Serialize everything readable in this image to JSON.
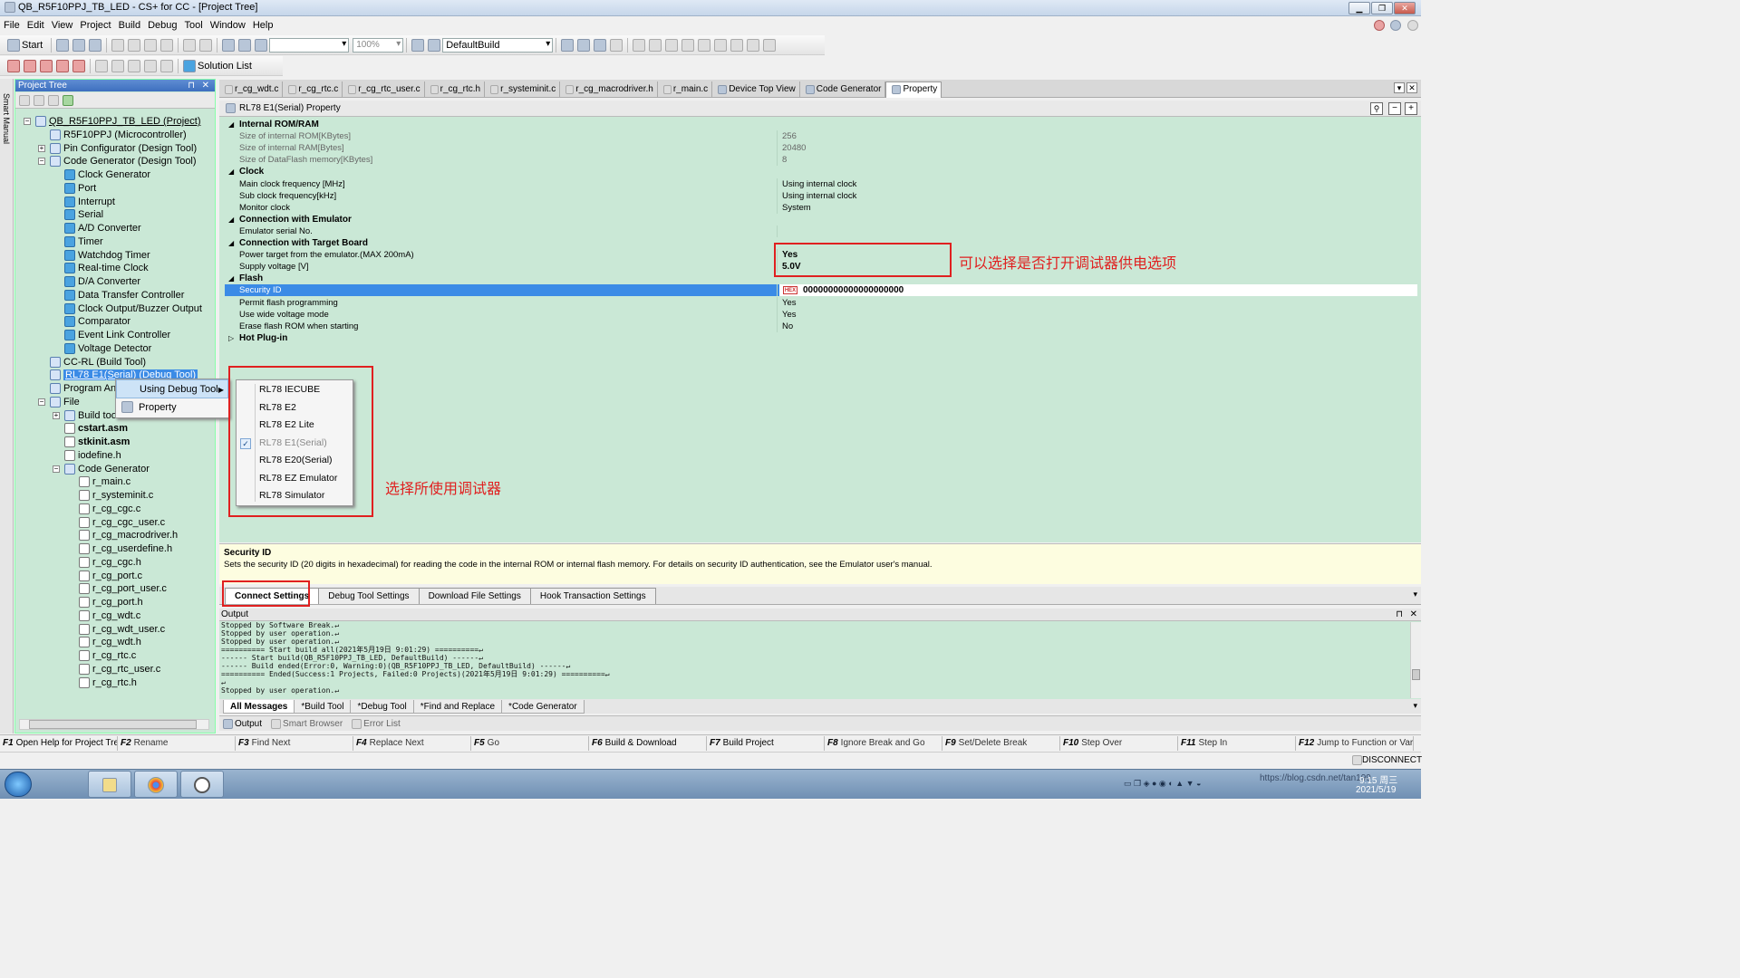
{
  "window": {
    "title": "QB_R5F10PPJ_TB_LED - CS+ for CC - [Project Tree]"
  },
  "menu": [
    "File",
    "Edit",
    "View",
    "Project",
    "Build",
    "Debug",
    "Tool",
    "Window",
    "Help"
  ],
  "toolbar": {
    "start_label": "Start",
    "zoom": "100%",
    "build_mode": "DefaultBuild",
    "solution_list": "Solution List"
  },
  "side_strip": {
    "label": "Smart Manual"
  },
  "project_tree": {
    "header": "Project Tree",
    "nodes": [
      {
        "label": "QB_R5F10PPJ_TB_LED (Project)"
      },
      {
        "label": "R5F10PPJ (Microcontroller)"
      },
      {
        "label": "Pin Configurator (Design Tool)"
      },
      {
        "label": "Code Generator (Design Tool)"
      },
      {
        "label": "Clock Generator"
      },
      {
        "label": "Port"
      },
      {
        "label": "Interrupt"
      },
      {
        "label": "Serial"
      },
      {
        "label": "A/D Converter"
      },
      {
        "label": "Timer"
      },
      {
        "label": "Watchdog Timer"
      },
      {
        "label": "Real-time Clock"
      },
      {
        "label": "D/A Converter"
      },
      {
        "label": "Data Transfer Controller"
      },
      {
        "label": "Clock Output/Buzzer Output"
      },
      {
        "label": "Comparator"
      },
      {
        "label": "Event Link Controller"
      },
      {
        "label": "Voltage Detector"
      },
      {
        "label": "CC-RL (Build Tool)"
      },
      {
        "label": "RL78 E1(Serial) (Debug Tool)"
      },
      {
        "label": "Program An"
      },
      {
        "label": "File"
      },
      {
        "label": "Build too"
      },
      {
        "label": "cstart.asm"
      },
      {
        "label": "stkinit.asm"
      },
      {
        "label": "iodefine.h"
      },
      {
        "label": "Code Generator"
      },
      {
        "label": "r_main.c"
      },
      {
        "label": "r_systeminit.c"
      },
      {
        "label": "r_cg_cgc.c"
      },
      {
        "label": "r_cg_cgc_user.c"
      },
      {
        "label": "r_cg_macrodriver.h"
      },
      {
        "label": "r_cg_userdefine.h"
      },
      {
        "label": "r_cg_cgc.h"
      },
      {
        "label": "r_cg_port.c"
      },
      {
        "label": "r_cg_port_user.c"
      },
      {
        "label": "r_cg_port.h"
      },
      {
        "label": "r_cg_wdt.c"
      },
      {
        "label": "r_cg_wdt_user.c"
      },
      {
        "label": "r_cg_wdt.h"
      },
      {
        "label": "r_cg_rtc.c"
      },
      {
        "label": "r_cg_rtc_user.c"
      },
      {
        "label": "r_cg_rtc.h"
      }
    ]
  },
  "context_menu": [
    {
      "label": "Using Debug Tool"
    },
    {
      "label": "Property"
    }
  ],
  "submenu": [
    {
      "label": "RL78 IECUBE"
    },
    {
      "label": "RL78 E2"
    },
    {
      "label": "RL78 E2 Lite"
    },
    {
      "label": "RL78 E1(Serial)",
      "checked": true,
      "disabled": true
    },
    {
      "label": "RL78 E20(Serial)"
    },
    {
      "label": "RL78 EZ Emulator"
    },
    {
      "label": "RL78 Simulator"
    }
  ],
  "doc_tabs": [
    "r_cg_wdt.c",
    "r_cg_rtc.c",
    "r_cg_rtc_user.c",
    "r_cg_rtc.h",
    "r_systeminit.c",
    "r_cg_macrodriver.h",
    "r_main.c",
    "Device Top View",
    "Code Generator",
    "Property"
  ],
  "property_panel": {
    "header": "RL78 E1(Serial) Property",
    "rows": [
      {
        "kind": "cat",
        "name": "Internal ROM/RAM",
        "value": ""
      },
      {
        "kind": "ro",
        "name": "Size of internal ROM[KBytes]",
        "value": "256"
      },
      {
        "kind": "ro",
        "name": "Size of internal RAM[Bytes]",
        "value": "20480"
      },
      {
        "kind": "ro",
        "name": "Size of DataFlash memory[KBytes]",
        "value": "8"
      },
      {
        "kind": "cat",
        "name": "Clock",
        "value": ""
      },
      {
        "kind": "row",
        "name": "Main clock frequency [MHz]",
        "value": "Using internal clock"
      },
      {
        "kind": "row",
        "name": "Sub clock frequency[kHz]",
        "value": "Using internal clock"
      },
      {
        "kind": "row",
        "name": "Monitor clock",
        "value": "System"
      },
      {
        "kind": "cat",
        "name": "Connection with Emulator",
        "value": ""
      },
      {
        "kind": "row",
        "name": "Emulator serial No.",
        "value": ""
      },
      {
        "kind": "cat",
        "name": "Connection with Target Board",
        "value": ""
      },
      {
        "kind": "bold",
        "name": "Power target from the emulator.(MAX 200mA)",
        "value": "Yes"
      },
      {
        "kind": "bold",
        "name": "Supply voltage [V]",
        "value": "5.0V"
      },
      {
        "kind": "cat",
        "name": "Flash",
        "value": ""
      },
      {
        "kind": "sel",
        "name": "Security ID",
        "value": "00000000000000000000"
      },
      {
        "kind": "row",
        "name": "Permit flash programming",
        "value": "Yes"
      },
      {
        "kind": "row",
        "name": "Use wide voltage mode",
        "value": "Yes"
      },
      {
        "kind": "row",
        "name": "Erase flash ROM when starting",
        "value": "No"
      },
      {
        "kind": "catc",
        "name": "Hot Plug-in",
        "value": ""
      }
    ],
    "hex_badge": "HEX"
  },
  "description": {
    "title": "Security ID",
    "text": "Sets the security ID (20 digits in hexadecimal) for reading the code in the internal ROM or internal flash memory. For details on security ID authentication, see the Emulator user's manual."
  },
  "property_tabs": [
    "Connect Settings",
    "Debug Tool Settings",
    "Download File Settings",
    "Hook Transaction Settings"
  ],
  "output": {
    "header": "Output",
    "lines": [
      "Stopped by Software Break.↵",
      "Stopped by user operation.↵",
      "Stopped by user operation.↵",
      "========== Start build all(2021年5月19日 9:01:29) ==========↵",
      "------ Start build(QB_R5F10PPJ_TB_LED, DefaultBuild) ------↵",
      "------ Build ended(Error:0, Warning:0)(QB_R5F10PPJ_TB_LED, DefaultBuild) ------↵",
      "========== Ended(Success:1 Projects, Failed:0 Projects)(2021年5月19日 9:01:29) ==========↵",
      "↵",
      "Stopped by user operation.↵"
    ]
  },
  "output_tabs": [
    "All Messages",
    "*Build Tool",
    "*Debug Tool",
    "*Find and Replace",
    "*Code Generator"
  ],
  "bottom_tabs": [
    "Output",
    "Smart Browser",
    "Error List"
  ],
  "function_keys": [
    {
      "key": "F1",
      "label": "Open Help for Project Tre.."
    },
    {
      "key": "F2",
      "label": "Rename"
    },
    {
      "key": "F3",
      "label": "Find Next"
    },
    {
      "key": "F4",
      "label": "Replace Next"
    },
    {
      "key": "F5",
      "label": "Go"
    },
    {
      "key": "F6",
      "label": "Build & Download"
    },
    {
      "key": "F7",
      "label": "Build Project"
    },
    {
      "key": "F8",
      "label": "Ignore Break and Go"
    },
    {
      "key": "F9",
      "label": "Set/Delete Break"
    },
    {
      "key": "F10",
      "label": "Step Over"
    },
    {
      "key": "F11",
      "label": "Step In"
    },
    {
      "key": "F12",
      "label": "Jump to Function or Varia.."
    }
  ],
  "status": {
    "connection": "DISCONNECT"
  },
  "taskbar": {
    "time": "9:15 周三",
    "date": "2021/5/19",
    "watermark": "https://blog.csdn.net/tan199"
  },
  "annotations": {
    "power_note": "可以选择是否打开调试器供电选项",
    "debugger_note": "选择所使用调试器"
  },
  "colors": {
    "panel_green": "#cae8d6",
    "selection_blue": "#3b8be6",
    "annotation_red": "#e02020"
  }
}
